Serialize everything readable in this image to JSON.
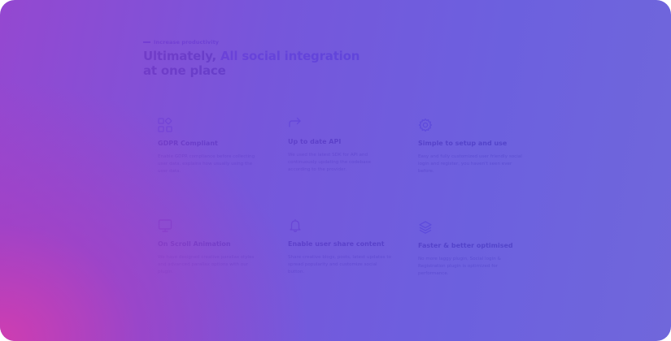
{
  "header": {
    "eyebrow": "Increase productivity",
    "title_part1": "Ultimately, ",
    "title_accent": "All social integration",
    "title_part2": "at one place"
  },
  "features": [
    {
      "icon": "grid-icon",
      "title": "GDPR Compliant",
      "description": "Enable GDPR compliance before collecting user data, explains how usually using the user data."
    },
    {
      "icon": "redirect-arrow-icon",
      "title": "Up to date API",
      "description": "We used the latest SDK for API and continuously updating the codebase according to the provider."
    },
    {
      "icon": "gear-icon",
      "title": "Simple to setup and use",
      "description": "Easy and fully customized user friendly social login and register, you haven't seen ever before."
    },
    {
      "icon": "monitor-icon",
      "title": "On Scroll Animation",
      "description": "We have designed creative parallax styles and advanced parallax options with our plugin."
    },
    {
      "icon": "bell-icon",
      "title": "Enable user share content",
      "description": "Share creative blogs, posts, latest updates to spread popularity and customize social button."
    },
    {
      "icon": "layers-icon",
      "title": "Faster & better optimised",
      "description": "No more laggy plugin, Social login & Registration plugin is optimized for performance."
    }
  ],
  "colors": {
    "accent": "#5a3df0",
    "heading": "#2a1758",
    "icon": "#6e5cf2",
    "overlay_left": "#d23caf",
    "overlay_right": "#5c52d6"
  }
}
